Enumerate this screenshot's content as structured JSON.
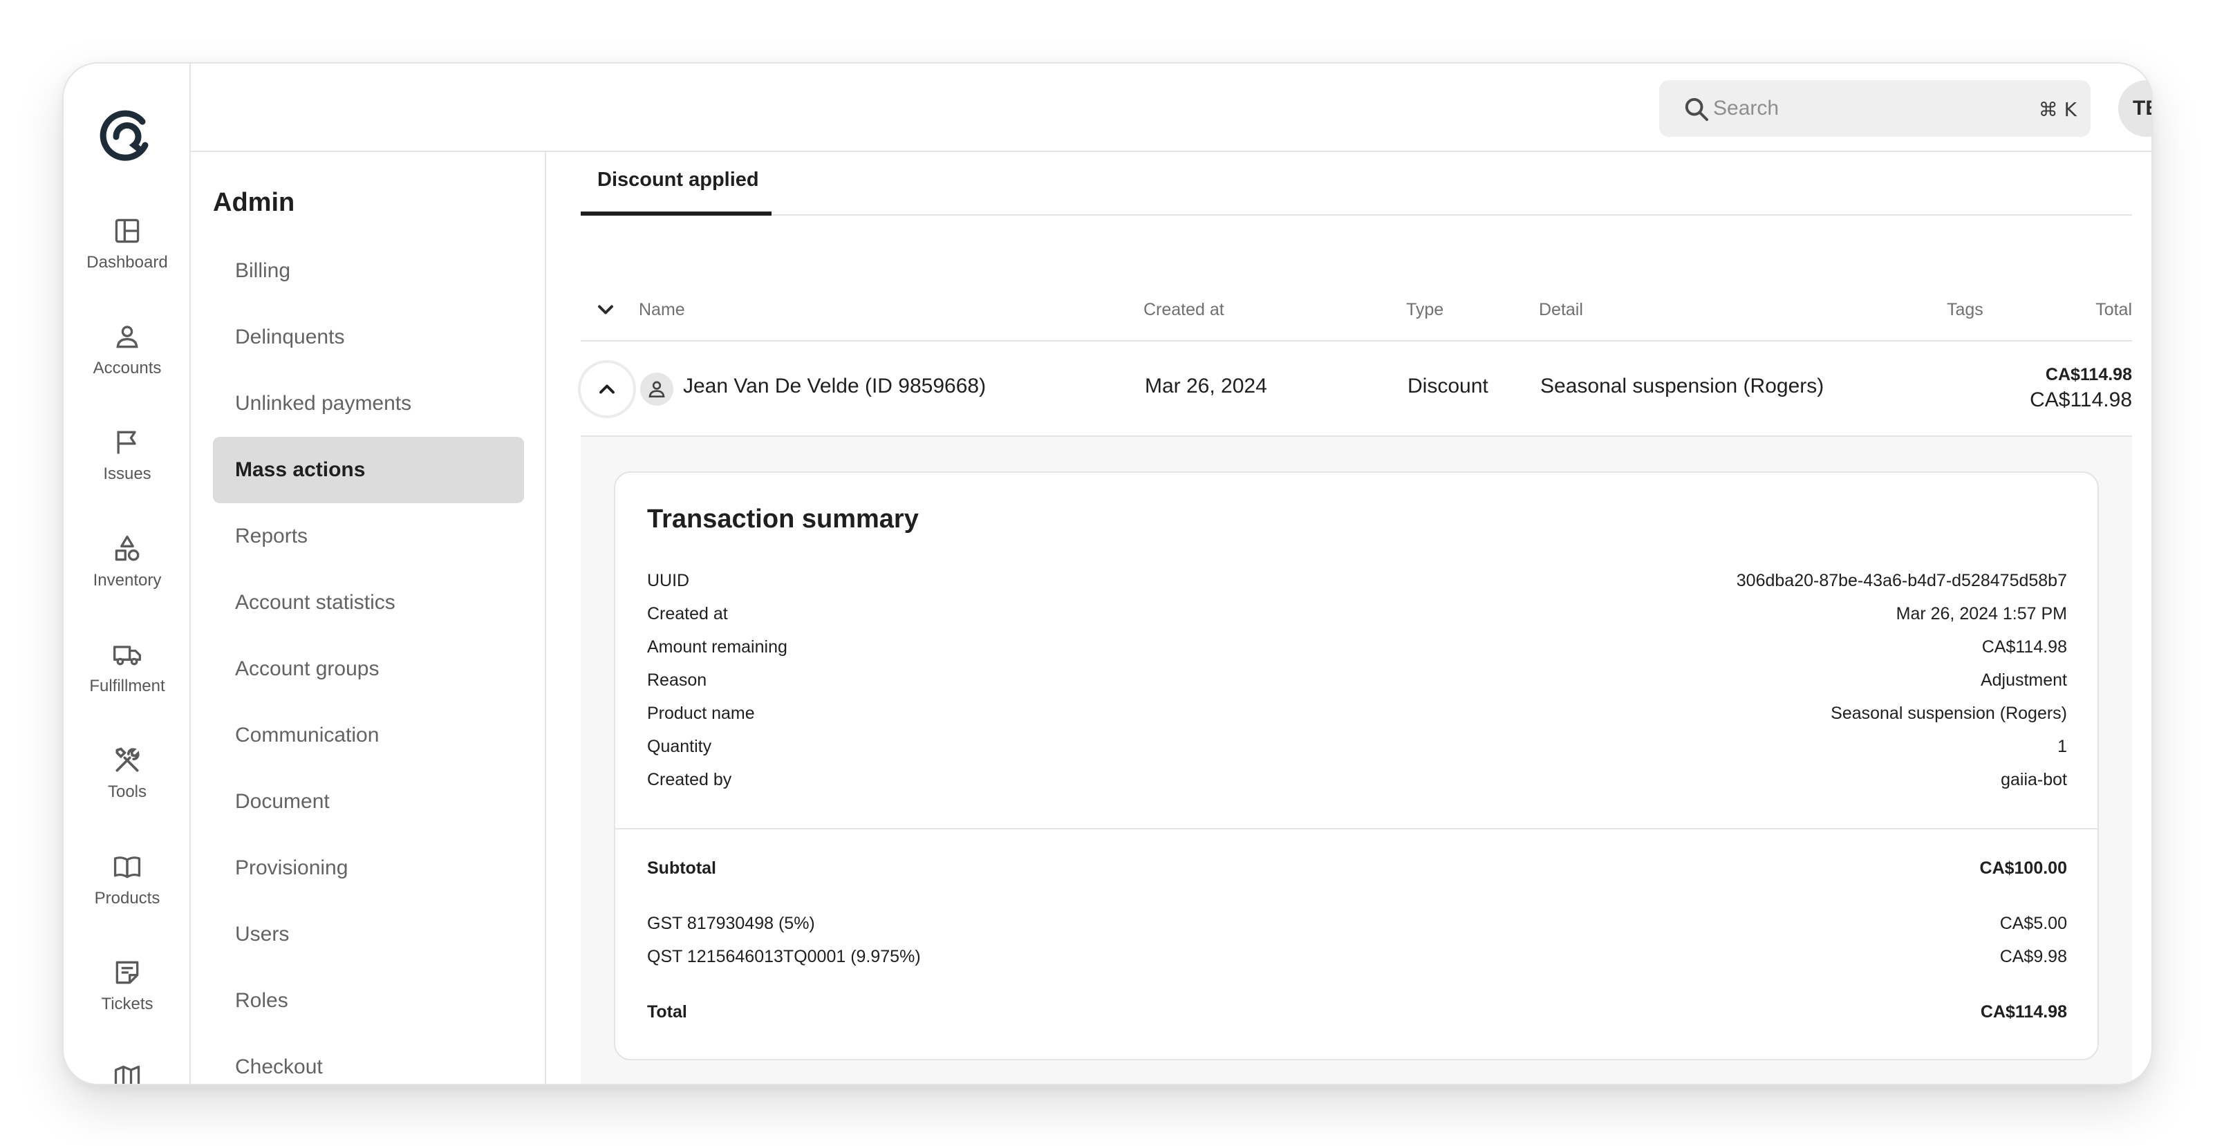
{
  "rail": {
    "items": [
      {
        "label": "Dashboard",
        "icon": "layout-icon"
      },
      {
        "label": "Accounts",
        "icon": "person-icon"
      },
      {
        "label": "Issues",
        "icon": "flag-icon"
      },
      {
        "label": "Inventory",
        "icon": "shapes-icon"
      },
      {
        "label": "Fulfillment",
        "icon": "truck-icon"
      },
      {
        "label": "Tools",
        "icon": "tools-icon"
      },
      {
        "label": "Products",
        "icon": "book-icon"
      },
      {
        "label": "Tickets",
        "icon": "note-icon"
      }
    ]
  },
  "topbar": {
    "search_placeholder": "Search",
    "search_shortcut": "⌘ K",
    "avatar_initials": "TB"
  },
  "admin": {
    "title": "Admin",
    "items": [
      {
        "label": "Billing"
      },
      {
        "label": "Delinquents"
      },
      {
        "label": "Unlinked payments"
      },
      {
        "label": "Mass actions",
        "active": true
      },
      {
        "label": "Reports"
      },
      {
        "label": "Account statistics"
      },
      {
        "label": "Account groups"
      },
      {
        "label": "Communication"
      },
      {
        "label": "Document"
      },
      {
        "label": "Provisioning"
      },
      {
        "label": "Users"
      },
      {
        "label": "Roles"
      },
      {
        "label": "Checkout"
      }
    ]
  },
  "main": {
    "tab_label": "Discount applied",
    "table": {
      "headers": {
        "name": "Name",
        "created_at": "Created at",
        "type": "Type",
        "detail": "Detail",
        "tags": "Tags",
        "total": "Total"
      },
      "row": {
        "name": "Jean Van De Velde (ID 9859668)",
        "created_at": "Mar 26, 2024",
        "type": "Discount",
        "detail": "Seasonal suspension (Rogers)",
        "total_primary": "CA$114.98",
        "total_secondary": "CA$114.98"
      }
    },
    "summary": {
      "title": "Transaction summary",
      "fields": [
        {
          "key": "UUID",
          "value": "306dba20-87be-43a6-b4d7-d528475d58b7"
        },
        {
          "key": "Created at",
          "value": "Mar 26, 2024 1:57 PM"
        },
        {
          "key": "Amount remaining",
          "value": "CA$114.98"
        },
        {
          "key": "Reason",
          "value": "Adjustment"
        },
        {
          "key": "Product name",
          "value": "Seasonal suspension (Rogers)"
        },
        {
          "key": "Quantity",
          "value": "1"
        },
        {
          "key": "Created by",
          "value": "gaiia-bot"
        }
      ],
      "subtotal": {
        "key": "Subtotal",
        "value": "CA$100.00"
      },
      "taxes": [
        {
          "key": "GST 817930498 (5%)",
          "value": "CA$5.00"
        },
        {
          "key": "QST 1215646013TQ0001 (9.975%)",
          "value": "CA$9.98"
        }
      ],
      "total": {
        "key": "Total",
        "value": "CA$114.98"
      }
    }
  }
}
